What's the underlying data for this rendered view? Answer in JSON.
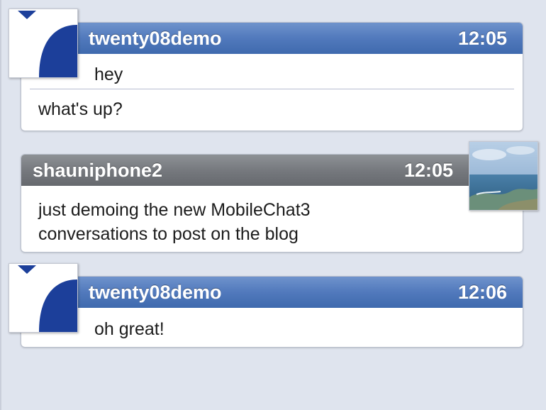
{
  "messages": [
    {
      "sender": "twenty08demo",
      "time": "12:05",
      "lines": [
        "hey",
        "what's up?"
      ],
      "style": "blue",
      "avatar": "blue-arc-avatar"
    },
    {
      "sender": "shauniphone2",
      "time": "12:05",
      "lines": [
        "just demoing the new MobileChat3",
        "conversations to post on the blog"
      ],
      "style": "gray",
      "avatar": "sea-photo-avatar"
    },
    {
      "sender": "twenty08demo",
      "time": "12:06",
      "lines": [
        "oh great!"
      ],
      "style": "blue",
      "avatar": "blue-arc-avatar"
    }
  ],
  "colors": {
    "background": "#dfe4ee",
    "outgoing_header": "#5179bc",
    "incoming_header": "#76797e",
    "avatar_blue": "#1c3f9a"
  }
}
